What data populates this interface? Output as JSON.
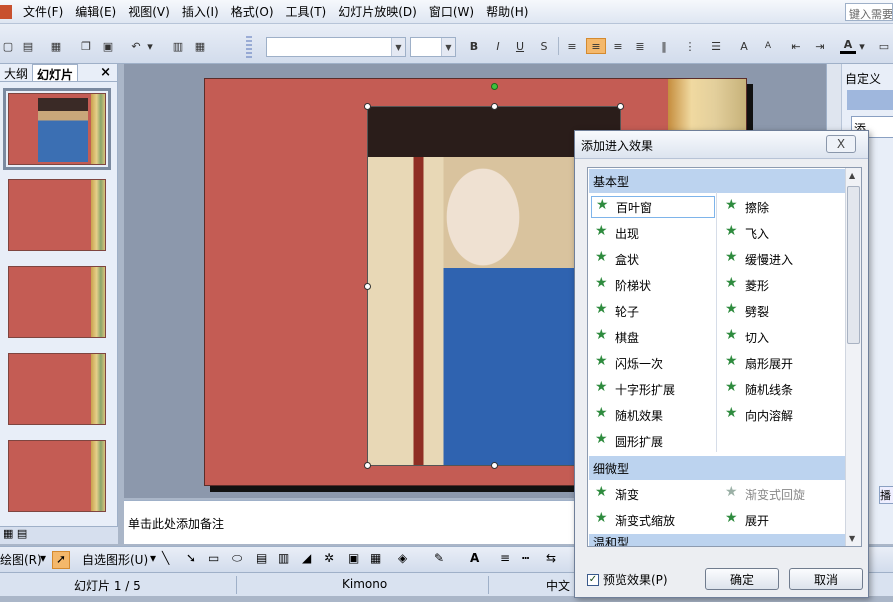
{
  "menu": [
    "文件(F)",
    "编辑(E)",
    "视图(V)",
    "插入(I)",
    "格式(O)",
    "工具(T)",
    "幻灯片放映(D)",
    "窗口(W)",
    "帮助(H)"
  ],
  "help_box": "键入需要",
  "toolbar": {
    "font_size_placeholder": ""
  },
  "left_tabs": {
    "outline": "大纲",
    "slides": "幻灯片",
    "close": "×"
  },
  "notes": {
    "placeholder": "单击此处添加备注"
  },
  "task_pane": {
    "title": "自定义",
    "add_button": "添",
    "side_label": "播"
  },
  "drawbar": {
    "draw_label": "绘图(R)",
    "autoshapes_label": "自选图形(U)"
  },
  "status": {
    "slide_label": "幻灯片 1 / 5",
    "design": "Kimono",
    "language": "中文"
  },
  "dialog": {
    "title": "添加进入效果",
    "close": "X",
    "groups": {
      "basic": "基本型",
      "subtle": "细微型",
      "moderate": "温和型"
    },
    "basic_left": [
      "百叶窗",
      "出现",
      "盒状",
      "阶梯状",
      "轮子",
      "棋盘",
      "闪烁一次",
      "十字形扩展",
      "随机效果",
      "圆形扩展"
    ],
    "basic_right": [
      "擦除",
      "飞入",
      "缓慢进入",
      "菱形",
      "劈裂",
      "切入",
      "扇形展开",
      "随机线条",
      "向内溶解"
    ],
    "subtle_left": [
      "渐变",
      "渐变式缩放"
    ],
    "subtle_right": [
      "渐变式回旋",
      "展开"
    ],
    "preview_label": "预览效果(P)",
    "ok": "确定",
    "cancel": "取消"
  }
}
